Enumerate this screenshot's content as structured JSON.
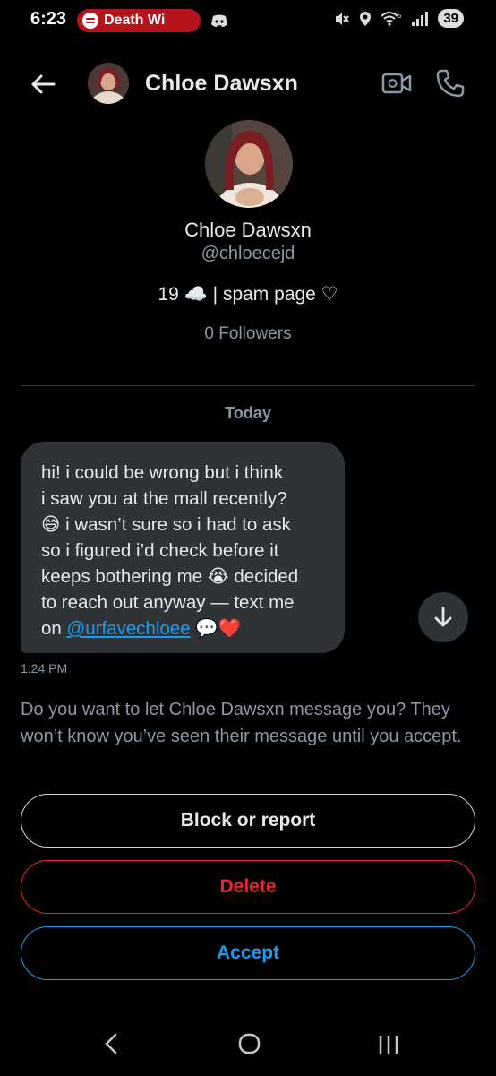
{
  "status_bar": {
    "time": "6:23",
    "media_title": "Death Wi",
    "battery": "39"
  },
  "header": {
    "name": "Chloe Dawsxn"
  },
  "profile": {
    "name": "Chloe Dawsxn",
    "handle": "@chloecejd",
    "bio": "19 ☁️ | spam page ♡",
    "followers": "0 Followers"
  },
  "conversation": {
    "date_separator": "Today",
    "message": {
      "text": "hi! i could be wrong but i think\ni saw you at the mall recently?\n😅 i wasn’t sure so i had to ask\nso i figured i’d check before it\nkeeps bothering me 😭 decided\nto reach out anyway — text me\non ",
      "link": "@urfavechloee",
      "trailing_emoji": "💬❤️",
      "time": "1:24 PM"
    }
  },
  "message_request": {
    "prompt": "Do you want to let Chloe Dawsxn message you? They won’t know you’ve seen their message until you accept.",
    "block_label": "Block or report",
    "delete_label": "Delete",
    "accept_label": "Accept"
  },
  "icons": {
    "back": "arrow-left-icon",
    "video": "video-camera-icon",
    "phone": "phone-icon",
    "scroll_down": "arrow-down-icon",
    "spotify": "spotify-icon",
    "discord": "discord-icon"
  },
  "colors": {
    "background": "#000000",
    "bubble": "#2f3336",
    "accent_blue": "#1d9bf0",
    "danger_red": "#f4212e",
    "secondary_text": "#8b98a5",
    "spotify_pill": "#b5141b"
  }
}
